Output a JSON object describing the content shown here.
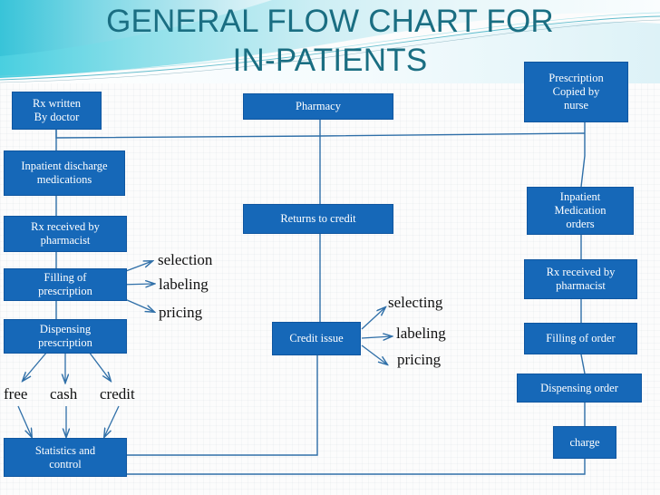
{
  "slide": {
    "title": "GENERAL FLOW CHART FOR IN-PATIENTS",
    "title_line1": "GENERAL FLOW CHART FOR",
    "title_line2": "IN-PATIENTS",
    "background_color": "#fcfcfc",
    "title_color": "#1a6e82",
    "node_fill_color": "#1668b8",
    "node_border_color": "#0f56a0",
    "node_text_color": "#ffffff",
    "connector_color": "#2f6fa8",
    "plain_label_color": "#111111"
  },
  "chart_data": {
    "type": "diagram",
    "title": "GENERAL FLOW CHART FOR IN-PATIENTS",
    "nodes": [
      {
        "id": "rx_written",
        "label": "Rx  written\nBy doctor",
        "column": "left",
        "text_line1": "Rx  written",
        "text_line2": "By doctor"
      },
      {
        "id": "inpatient_discharge",
        "label": "Inpatient discharge medications",
        "column": "left",
        "text_line1": "Inpatient discharge",
        "text_line2": "medications"
      },
      {
        "id": "rx_received_left",
        "label": "Rx  received by pharmacist",
        "column": "left",
        "text_line1": "Rx  received by",
        "text_line2": "pharmacist"
      },
      {
        "id": "filling_prescription",
        "label": "Filling of prescription",
        "column": "left",
        "text_line1": "Filling of",
        "text_line2": "prescription"
      },
      {
        "id": "dispensing_prescription",
        "label": "Dispensing prescription",
        "column": "left",
        "text_line1": "Dispensing",
        "text_line2": "prescription"
      },
      {
        "id": "statistics_control",
        "label": "Statistics and control",
        "column": "left",
        "text_line1": "Statistics and",
        "text_line2": "control"
      },
      {
        "id": "pharmacy",
        "label": "Pharmacy",
        "column": "middle",
        "text_line1": "Pharmacy",
        "text_line2": ""
      },
      {
        "id": "returns_to_credit",
        "label": "Returns to credit",
        "column": "middle",
        "text_line1": "Returns to credit",
        "text_line2": ""
      },
      {
        "id": "credit_issue",
        "label": "Credit issue",
        "column": "middle",
        "text_line1": "Credit issue",
        "text_line2": ""
      },
      {
        "id": "prescription_copied",
        "label": "Prescription Copied by nurse",
        "column": "right",
        "text_line1": "Prescription",
        "text_line2": "Copied by",
        "text_line3": "nurse"
      },
      {
        "id": "inpatient_med_orders",
        "label": "Inpatient Medication orders",
        "column": "right",
        "text_line1": "Inpatient",
        "text_line2": "Medication",
        "text_line3": "orders"
      },
      {
        "id": "rx_received_right",
        "label": "Rx received by pharmacist",
        "column": "right",
        "text_line1": "Rx received by",
        "text_line2": "pharmacist"
      },
      {
        "id": "filling_of_order",
        "label": "Filling of order",
        "column": "right",
        "text_line1": "Filling of order",
        "text_line2": ""
      },
      {
        "id": "dispensing_order",
        "label": "Dispensing order",
        "column": "right",
        "text_line1": "Dispensing order",
        "text_line2": ""
      },
      {
        "id": "charge",
        "label": "charge",
        "column": "right",
        "text_line1": "charge",
        "text_line2": ""
      }
    ],
    "branch_labels": {
      "filling_prescription_outputs": [
        "selection",
        "labeling",
        "pricing"
      ],
      "credit_issue_outputs": [
        "selecting",
        "labeling",
        "pricing"
      ],
      "payment_modes": [
        "free",
        "cash",
        "credit"
      ]
    },
    "edges": [
      {
        "from": "rx_written",
        "to": "inpatient_discharge",
        "style": "line"
      },
      {
        "from": "rx_written",
        "to": "pharmacy",
        "style": "horizontal-bus"
      },
      {
        "from": "rx_written",
        "to": "prescription_copied",
        "style": "horizontal-bus"
      },
      {
        "from": "inpatient_discharge",
        "to": "rx_received_left",
        "style": "line"
      },
      {
        "from": "rx_received_left",
        "to": "filling_prescription",
        "style": "line"
      },
      {
        "from": "filling_prescription",
        "to": "dispensing_prescription",
        "style": "line"
      },
      {
        "from": "filling_prescription",
        "to": "selection",
        "style": "arrow"
      },
      {
        "from": "filling_prescription",
        "to": "labeling",
        "style": "arrow"
      },
      {
        "from": "filling_prescription",
        "to": "pricing",
        "style": "arrow"
      },
      {
        "from": "dispensing_prescription",
        "to": "free",
        "style": "arrow"
      },
      {
        "from": "dispensing_prescription",
        "to": "cash",
        "style": "arrow"
      },
      {
        "from": "dispensing_prescription",
        "to": "credit",
        "style": "arrow"
      },
      {
        "from": "free",
        "to": "statistics_control",
        "style": "arrow"
      },
      {
        "from": "cash",
        "to": "statistics_control",
        "style": "arrow"
      },
      {
        "from": "credit",
        "to": "statistics_control",
        "style": "arrow"
      },
      {
        "from": "pharmacy",
        "to": "returns_to_credit",
        "style": "line"
      },
      {
        "from": "returns_to_credit",
        "to": "credit_issue",
        "style": "line"
      },
      {
        "from": "credit_issue",
        "to": "selecting",
        "style": "arrow"
      },
      {
        "from": "credit_issue",
        "to": "labeling",
        "style": "arrow"
      },
      {
        "from": "credit_issue",
        "to": "pricing",
        "style": "arrow"
      },
      {
        "from": "credit_issue",
        "to": "statistics_control",
        "style": "elbow"
      },
      {
        "from": "prescription_copied",
        "to": "inpatient_med_orders",
        "style": "line"
      },
      {
        "from": "inpatient_med_orders",
        "to": "rx_received_right",
        "style": "line"
      },
      {
        "from": "rx_received_right",
        "to": "filling_of_order",
        "style": "line"
      },
      {
        "from": "filling_of_order",
        "to": "dispensing_order",
        "style": "line"
      },
      {
        "from": "dispensing_order",
        "to": "charge",
        "style": "line"
      },
      {
        "from": "charge",
        "to": "statistics_control",
        "style": "elbow"
      }
    ]
  }
}
